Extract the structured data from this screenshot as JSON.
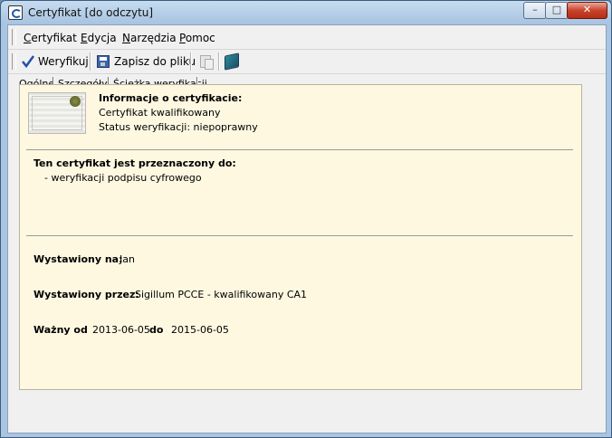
{
  "window": {
    "title": "Certyfikat [do odczytu]",
    "minimize": "–",
    "maximize": "□",
    "close": "✕"
  },
  "menu": {
    "items": [
      "Certyfikat",
      "Edycja",
      "Narzędzia",
      "Pomoc"
    ]
  },
  "toolbar": {
    "verify_label": "Weryfikuj",
    "save_label": "Zapisz do pliku"
  },
  "tabs": [
    "Ogólne",
    "Szczegóły",
    "Ścieżka weryfikacji"
  ],
  "info": {
    "heading": "Informacje o certyfikacie:",
    "type": "Certyfikat kwalifikowany",
    "status": "Status weryfikacji: niepoprawny"
  },
  "purpose": {
    "heading": "Ten certyfikat jest przeznaczony do:",
    "items": [
      "- weryfikacji podpisu cyfrowego"
    ]
  },
  "issued_to": {
    "label": "Wystawiony na:",
    "value": "Jan"
  },
  "issued_by": {
    "label": "Wystawiony przez:",
    "value": "Sigillum PCCE - kwalifikowany CA1"
  },
  "validity": {
    "from_label": "Ważny od",
    "from": "2013-06-05",
    "to_label": "do",
    "to": "2015-06-05"
  },
  "icons": {
    "app": "certificate-app-icon",
    "verify": "checkmark-icon",
    "save": "floppy-disk-icon",
    "copy": "copy-icon",
    "book": "book-icon",
    "certificate": "certificate-document-icon"
  }
}
